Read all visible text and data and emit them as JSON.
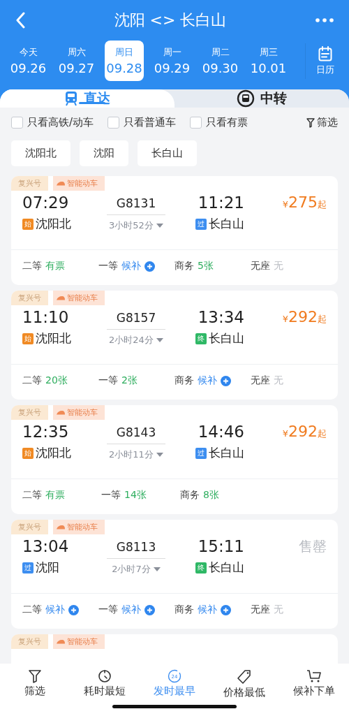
{
  "header": {
    "title": "沈阳 <> 长白山"
  },
  "dates": [
    {
      "weekday": "今天",
      "date": "09.26",
      "selected": false
    },
    {
      "weekday": "周六",
      "date": "09.27",
      "selected": false
    },
    {
      "weekday": "周日",
      "date": "09.28",
      "selected": true
    },
    {
      "weekday": "周一",
      "date": "09.29",
      "selected": false
    },
    {
      "weekday": "周二",
      "date": "09.30",
      "selected": false
    },
    {
      "weekday": "周三",
      "date": "10.01",
      "selected": false
    }
  ],
  "calendar": {
    "label": "日历"
  },
  "tabs": [
    {
      "label": "直达",
      "kind": "direct",
      "selected": true
    },
    {
      "label": "中转",
      "kind": "transfer",
      "selected": false
    }
  ],
  "filters": [
    {
      "label": "只看高铁/动车",
      "checked": false
    },
    {
      "label": "只看普通车",
      "checked": false
    },
    {
      "label": "只看有票",
      "checked": false
    }
  ],
  "filter_button": {
    "label": "筛选"
  },
  "stations": [
    "沈阳北",
    "沈阳",
    "长白山"
  ],
  "trains": [
    {
      "tags": [
        "复兴号",
        "智能动车"
      ],
      "depart_time": "07:29",
      "train_no": "G8131",
      "duration": "3小时52分",
      "arrive_time": "11:21",
      "from": {
        "mark": "始",
        "color": "#f08a24",
        "name": "沈阳北"
      },
      "to": {
        "mark": "过",
        "color": "#3d8ef0",
        "name": "长白山"
      },
      "price": {
        "kind": "price",
        "currency": "¥",
        "amount": "275",
        "suffix": "起"
      },
      "seats": [
        {
          "class": "二等",
          "status": "有票",
          "kind": "available"
        },
        {
          "class": "一等",
          "status": "候补",
          "kind": "waitlist"
        },
        {
          "class": "商务",
          "status": "5张",
          "kind": "available"
        },
        {
          "class": "无座",
          "status": "无",
          "kind": "none"
        }
      ]
    },
    {
      "tags": [
        "复兴号",
        "智能动车"
      ],
      "depart_time": "11:10",
      "train_no": "G8157",
      "duration": "2小时24分",
      "arrive_time": "13:34",
      "from": {
        "mark": "始",
        "color": "#f08a24",
        "name": "沈阳北"
      },
      "to": {
        "mark": "终",
        "color": "#2fb866",
        "name": "长白山"
      },
      "price": {
        "kind": "price",
        "currency": "¥",
        "amount": "292",
        "suffix": "起"
      },
      "seats": [
        {
          "class": "二等",
          "status": "20张",
          "kind": "available"
        },
        {
          "class": "一等",
          "status": "2张",
          "kind": "available"
        },
        {
          "class": "商务",
          "status": "候补",
          "kind": "waitlist"
        },
        {
          "class": "无座",
          "status": "无",
          "kind": "none"
        }
      ]
    },
    {
      "tags": [
        "复兴号",
        "智能动车"
      ],
      "depart_time": "12:35",
      "train_no": "G8143",
      "duration": "2小时11分",
      "arrive_time": "14:46",
      "from": {
        "mark": "始",
        "color": "#f08a24",
        "name": "沈阳北"
      },
      "to": {
        "mark": "过",
        "color": "#3d8ef0",
        "name": "长白山"
      },
      "price": {
        "kind": "price",
        "currency": "¥",
        "amount": "292",
        "suffix": "起"
      },
      "seats": [
        {
          "class": "二等",
          "status": "有票",
          "kind": "available"
        },
        {
          "class": "一等",
          "status": "14张",
          "kind": "available"
        },
        {
          "class": "商务",
          "status": "8张",
          "kind": "available"
        }
      ]
    },
    {
      "tags": [
        "复兴号",
        "智能动车"
      ],
      "depart_time": "13:04",
      "train_no": "G8113",
      "duration": "2小时7分",
      "arrive_time": "15:11",
      "from": {
        "mark": "过",
        "color": "#3d8ef0",
        "name": "沈阳"
      },
      "to": {
        "mark": "终",
        "color": "#2fb866",
        "name": "长白山"
      },
      "price": {
        "kind": "soldout",
        "label": "售罄"
      },
      "seats": [
        {
          "class": "二等",
          "status": "候补",
          "kind": "waitlist"
        },
        {
          "class": "一等",
          "status": "候补",
          "kind": "waitlist"
        },
        {
          "class": "商务",
          "status": "候补",
          "kind": "waitlist"
        },
        {
          "class": "无座",
          "status": "无",
          "kind": "none"
        }
      ]
    },
    {
      "tags": [
        "复兴号",
        "智能动车"
      ]
    }
  ],
  "bottom_nav": [
    {
      "label": "筛选",
      "kind": "filter",
      "selected": false
    },
    {
      "label": "耗时最短",
      "kind": "clock",
      "selected": false
    },
    {
      "label": "发时最早",
      "kind": "earliest",
      "icon_text": "24",
      "selected": true
    },
    {
      "label": "价格最低",
      "kind": "tag",
      "selected": false
    },
    {
      "label": "候补下单",
      "kind": "cart",
      "selected": false
    }
  ]
}
